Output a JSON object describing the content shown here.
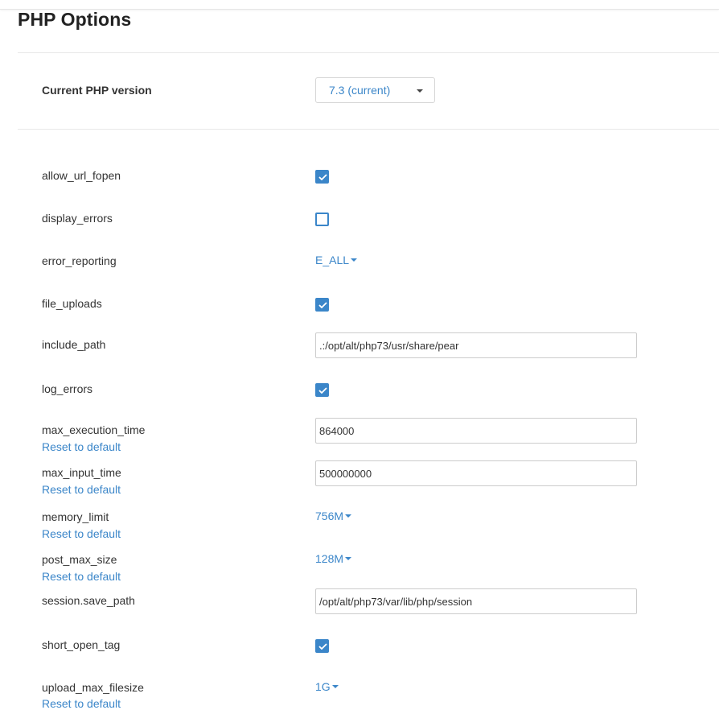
{
  "page": {
    "title": "PHP Options"
  },
  "php_version": {
    "label": "Current PHP version",
    "selected": "7.3 (current)"
  },
  "options": {
    "allow_url_fopen": {
      "name": "allow_url_fopen",
      "type": "checkbox",
      "checked": true
    },
    "display_errors": {
      "name": "display_errors",
      "type": "checkbox",
      "checked": false
    },
    "error_reporting": {
      "name": "error_reporting",
      "type": "dropdown",
      "value": "E_ALL"
    },
    "file_uploads": {
      "name": "file_uploads",
      "type": "checkbox",
      "checked": true
    },
    "include_path": {
      "name": "include_path",
      "type": "text",
      "value": ".:/opt/alt/php73/usr/share/pear"
    },
    "log_errors": {
      "name": "log_errors",
      "type": "checkbox",
      "checked": true
    },
    "max_execution_time": {
      "name": "max_execution_time",
      "type": "text",
      "value": "864000",
      "reset": "Reset to default"
    },
    "max_input_time": {
      "name": "max_input_time",
      "type": "text",
      "value": "500000000",
      "reset": "Reset to default"
    },
    "memory_limit": {
      "name": "memory_limit",
      "type": "dropdown",
      "value": "756M",
      "reset": "Reset to default"
    },
    "post_max_size": {
      "name": "post_max_size",
      "type": "dropdown",
      "value": "128M",
      "reset": "Reset to default"
    },
    "session_save_path": {
      "name": "session.save_path",
      "type": "text",
      "value": "/opt/alt/php73/var/lib/php/session"
    },
    "short_open_tag": {
      "name": "short_open_tag",
      "type": "checkbox",
      "checked": true
    },
    "upload_max_filesize": {
      "name": "upload_max_filesize",
      "type": "dropdown",
      "value": "1G",
      "reset": "Reset to default"
    }
  },
  "colors": {
    "accent": "#3b86c9",
    "text": "#333333",
    "border": "#cccccc",
    "divider": "#e8e8e8"
  },
  "icons": {
    "checkbox_checked": "checkmark-icon",
    "dropdown": "caret-down-icon"
  }
}
